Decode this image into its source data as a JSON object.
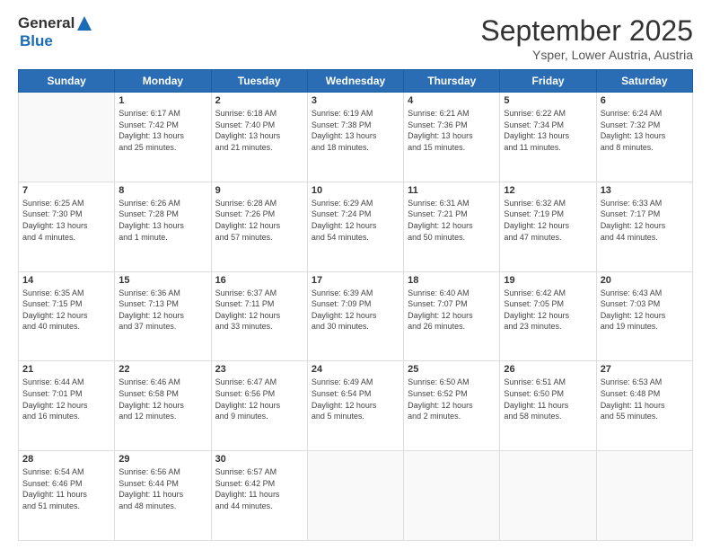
{
  "logo": {
    "general": "General",
    "blue": "Blue"
  },
  "header": {
    "month": "September 2025",
    "location": "Ysper, Lower Austria, Austria"
  },
  "days": [
    "Sunday",
    "Monday",
    "Tuesday",
    "Wednesday",
    "Thursday",
    "Friday",
    "Saturday"
  ],
  "weeks": [
    [
      {
        "day": "",
        "info": ""
      },
      {
        "day": "1",
        "info": "Sunrise: 6:17 AM\nSunset: 7:42 PM\nDaylight: 13 hours\nand 25 minutes."
      },
      {
        "day": "2",
        "info": "Sunrise: 6:18 AM\nSunset: 7:40 PM\nDaylight: 13 hours\nand 21 minutes."
      },
      {
        "day": "3",
        "info": "Sunrise: 6:19 AM\nSunset: 7:38 PM\nDaylight: 13 hours\nand 18 minutes."
      },
      {
        "day": "4",
        "info": "Sunrise: 6:21 AM\nSunset: 7:36 PM\nDaylight: 13 hours\nand 15 minutes."
      },
      {
        "day": "5",
        "info": "Sunrise: 6:22 AM\nSunset: 7:34 PM\nDaylight: 13 hours\nand 11 minutes."
      },
      {
        "day": "6",
        "info": "Sunrise: 6:24 AM\nSunset: 7:32 PM\nDaylight: 13 hours\nand 8 minutes."
      }
    ],
    [
      {
        "day": "7",
        "info": "Sunrise: 6:25 AM\nSunset: 7:30 PM\nDaylight: 13 hours\nand 4 minutes."
      },
      {
        "day": "8",
        "info": "Sunrise: 6:26 AM\nSunset: 7:28 PM\nDaylight: 13 hours\nand 1 minute."
      },
      {
        "day": "9",
        "info": "Sunrise: 6:28 AM\nSunset: 7:26 PM\nDaylight: 12 hours\nand 57 minutes."
      },
      {
        "day": "10",
        "info": "Sunrise: 6:29 AM\nSunset: 7:24 PM\nDaylight: 12 hours\nand 54 minutes."
      },
      {
        "day": "11",
        "info": "Sunrise: 6:31 AM\nSunset: 7:21 PM\nDaylight: 12 hours\nand 50 minutes."
      },
      {
        "day": "12",
        "info": "Sunrise: 6:32 AM\nSunset: 7:19 PM\nDaylight: 12 hours\nand 47 minutes."
      },
      {
        "day": "13",
        "info": "Sunrise: 6:33 AM\nSunset: 7:17 PM\nDaylight: 12 hours\nand 44 minutes."
      }
    ],
    [
      {
        "day": "14",
        "info": "Sunrise: 6:35 AM\nSunset: 7:15 PM\nDaylight: 12 hours\nand 40 minutes."
      },
      {
        "day": "15",
        "info": "Sunrise: 6:36 AM\nSunset: 7:13 PM\nDaylight: 12 hours\nand 37 minutes."
      },
      {
        "day": "16",
        "info": "Sunrise: 6:37 AM\nSunset: 7:11 PM\nDaylight: 12 hours\nand 33 minutes."
      },
      {
        "day": "17",
        "info": "Sunrise: 6:39 AM\nSunset: 7:09 PM\nDaylight: 12 hours\nand 30 minutes."
      },
      {
        "day": "18",
        "info": "Sunrise: 6:40 AM\nSunset: 7:07 PM\nDaylight: 12 hours\nand 26 minutes."
      },
      {
        "day": "19",
        "info": "Sunrise: 6:42 AM\nSunset: 7:05 PM\nDaylight: 12 hours\nand 23 minutes."
      },
      {
        "day": "20",
        "info": "Sunrise: 6:43 AM\nSunset: 7:03 PM\nDaylight: 12 hours\nand 19 minutes."
      }
    ],
    [
      {
        "day": "21",
        "info": "Sunrise: 6:44 AM\nSunset: 7:01 PM\nDaylight: 12 hours\nand 16 minutes."
      },
      {
        "day": "22",
        "info": "Sunrise: 6:46 AM\nSunset: 6:58 PM\nDaylight: 12 hours\nand 12 minutes."
      },
      {
        "day": "23",
        "info": "Sunrise: 6:47 AM\nSunset: 6:56 PM\nDaylight: 12 hours\nand 9 minutes."
      },
      {
        "day": "24",
        "info": "Sunrise: 6:49 AM\nSunset: 6:54 PM\nDaylight: 12 hours\nand 5 minutes."
      },
      {
        "day": "25",
        "info": "Sunrise: 6:50 AM\nSunset: 6:52 PM\nDaylight: 12 hours\nand 2 minutes."
      },
      {
        "day": "26",
        "info": "Sunrise: 6:51 AM\nSunset: 6:50 PM\nDaylight: 11 hours\nand 58 minutes."
      },
      {
        "day": "27",
        "info": "Sunrise: 6:53 AM\nSunset: 6:48 PM\nDaylight: 11 hours\nand 55 minutes."
      }
    ],
    [
      {
        "day": "28",
        "info": "Sunrise: 6:54 AM\nSunset: 6:46 PM\nDaylight: 11 hours\nand 51 minutes."
      },
      {
        "day": "29",
        "info": "Sunrise: 6:56 AM\nSunset: 6:44 PM\nDaylight: 11 hours\nand 48 minutes."
      },
      {
        "day": "30",
        "info": "Sunrise: 6:57 AM\nSunset: 6:42 PM\nDaylight: 11 hours\nand 44 minutes."
      },
      {
        "day": "",
        "info": ""
      },
      {
        "day": "",
        "info": ""
      },
      {
        "day": "",
        "info": ""
      },
      {
        "day": "",
        "info": ""
      }
    ]
  ]
}
